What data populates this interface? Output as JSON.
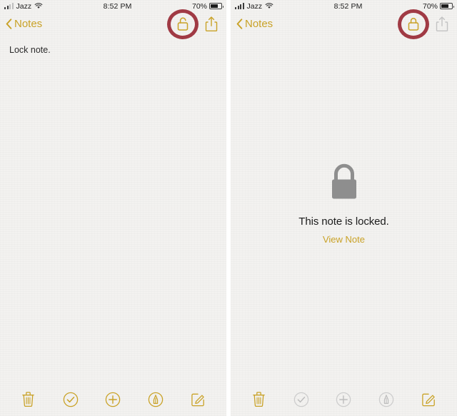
{
  "colors": {
    "gold": "#c9a227",
    "annotation_red": "#a03a44",
    "disabled_gray": "#b6b6b6",
    "lock_gray": "#8e8e8e",
    "paper": "#f3f2f0",
    "text": "#1c1c1c"
  },
  "panels": [
    {
      "id": "unlocked-note",
      "status_bar": {
        "signal_icon": "signal-bars-icon",
        "signal_strength": 2,
        "carrier": "Jazz",
        "wifi_icon": "wifi-icon",
        "time": "8:52 PM",
        "battery_percent": "70%",
        "battery_icon": "battery-icon",
        "battery_level": 70
      },
      "nav": {
        "back_icon": "chevron-left-icon",
        "back_label": "Notes",
        "lock_icon": "unlocked-padlock-icon",
        "lock_state": "unlocked",
        "share_icon": "share-icon",
        "share_enabled": true,
        "annotation": "red-circle-annotation"
      },
      "note": {
        "text": "Lock note."
      },
      "toolbar": [
        {
          "name": "delete-button",
          "icon": "trash-icon",
          "enabled": true
        },
        {
          "name": "checklist-button",
          "icon": "check-circle-icon",
          "enabled": true
        },
        {
          "name": "add-button",
          "icon": "plus-circle-icon",
          "enabled": true
        },
        {
          "name": "markup-button",
          "icon": "markup-pen-circle-icon",
          "enabled": true
        },
        {
          "name": "compose-button",
          "icon": "compose-icon",
          "enabled": true
        }
      ]
    },
    {
      "id": "locked-note",
      "status_bar": {
        "signal_icon": "signal-bars-icon",
        "signal_strength": 4,
        "carrier": "Jazz",
        "wifi_icon": "wifi-icon",
        "time": "8:52 PM",
        "battery_percent": "70%",
        "battery_icon": "battery-icon",
        "battery_level": 70
      },
      "nav": {
        "back_icon": "chevron-left-icon",
        "back_label": "Notes",
        "lock_icon": "locked-padlock-icon",
        "lock_state": "locked",
        "share_icon": "share-icon",
        "share_enabled": false,
        "annotation": "red-circle-annotation"
      },
      "locked": {
        "lock_icon": "large-locked-padlock-icon",
        "message": "This note is locked.",
        "link_label": "View Note"
      },
      "toolbar": [
        {
          "name": "delete-button",
          "icon": "trash-icon",
          "enabled": true
        },
        {
          "name": "checklist-button",
          "icon": "check-circle-icon",
          "enabled": false
        },
        {
          "name": "add-button",
          "icon": "plus-circle-icon",
          "enabled": false
        },
        {
          "name": "markup-button",
          "icon": "markup-pen-circle-icon",
          "enabled": false
        },
        {
          "name": "compose-button",
          "icon": "compose-icon",
          "enabled": true
        }
      ]
    }
  ]
}
